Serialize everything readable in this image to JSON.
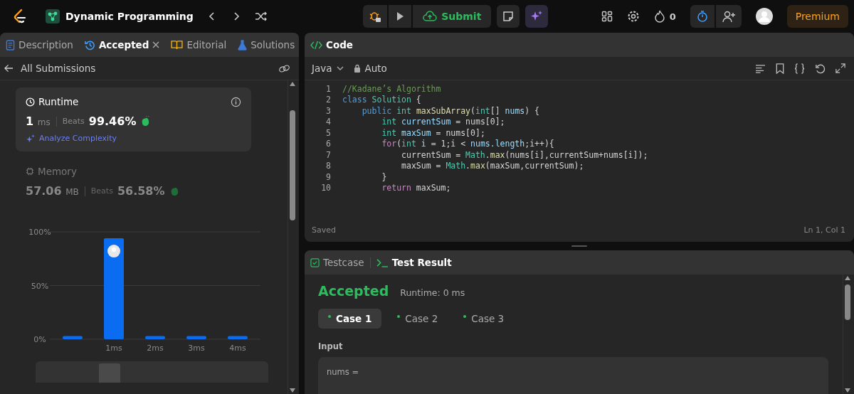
{
  "topbar": {
    "problem_list": "Dynamic Programming",
    "submit": "Submit",
    "streak": "0",
    "timer_active": true,
    "premium": "Premium"
  },
  "left_panel": {
    "tabs": [
      {
        "label": "Description",
        "kind": "description",
        "selected": false,
        "closable": false
      },
      {
        "label": "Accepted",
        "kind": "history",
        "selected": true,
        "closable": true
      },
      {
        "label": "Editorial",
        "kind": "book",
        "selected": false,
        "closable": false
      },
      {
        "label": "Solutions",
        "kind": "flask",
        "selected": false,
        "closable": false
      }
    ],
    "back_link": "All Submissions",
    "runtime": {
      "title": "Runtime",
      "value": "1 ",
      "unit": "ms",
      "beats_label": "Beats",
      "beats": "99.46%",
      "analyze": "Analyze Complexity",
      "selected": true
    },
    "memory": {
      "title": "Memory",
      "value": "57.06 ",
      "unit": "MB",
      "beats_label": "Beats",
      "beats": "56.58%",
      "selected": false
    },
    "chart_data": {
      "type": "bar",
      "categories": [
        null,
        "1ms",
        "2ms",
        "3ms",
        "4ms"
      ],
      "values": [
        3,
        94,
        3,
        3,
        3
      ],
      "yticks": [
        {
          "value": 0,
          "label": "0%"
        },
        {
          "value": 50,
          "label": "50%"
        },
        {
          "value": 100,
          "label": "100%"
        }
      ],
      "ylim": [
        0,
        100
      ]
    },
    "range": {
      "level": 0.3
    }
  },
  "code_panel": {
    "title": "Code",
    "language": "Java",
    "mode": "Auto",
    "status": "Saved",
    "cursor": "Ln 1, Col 1",
    "lines": [
      {
        "number": "1",
        "tokens": [
          {
            "t": "//Kadane’s Algorithm",
            "kind": "comment"
          }
        ]
      },
      {
        "number": "2",
        "tokens": [
          {
            "t": "class ",
            "kind": "keyword"
          },
          {
            "t": "Solution",
            "kind": "class"
          },
          {
            "t": " {",
            "kind": "plain"
          }
        ]
      },
      {
        "number": "3",
        "tokens": [
          {
            "t": "    public ",
            "kind": "keyword"
          },
          {
            "t": "int ",
            "kind": "type"
          },
          {
            "t": "maxSubArray",
            "kind": "function"
          },
          {
            "t": "(",
            "kind": "plain"
          },
          {
            "t": "int",
            "kind": "type"
          },
          {
            "t": "[] ",
            "kind": "plain"
          },
          {
            "t": "nums",
            "kind": "variable"
          },
          {
            "t": ") {",
            "kind": "plain"
          }
        ]
      },
      {
        "number": "4",
        "tokens": [
          {
            "t": "        int ",
            "kind": "type"
          },
          {
            "t": "currentSum",
            "kind": "variable"
          },
          {
            "t": " = nums[0];",
            "kind": "plain"
          }
        ]
      },
      {
        "number": "5",
        "tokens": [
          {
            "t": "        int ",
            "kind": "type"
          },
          {
            "t": "maxSum",
            "kind": "variable"
          },
          {
            "t": " = nums[0];",
            "kind": "plain"
          }
        ]
      },
      {
        "number": "6",
        "tokens": [
          {
            "t": "        for",
            "kind": "control"
          },
          {
            "t": "(",
            "kind": "plain"
          },
          {
            "t": "int ",
            "kind": "type"
          },
          {
            "t": "i",
            "kind": "variable"
          },
          {
            "t": " = 1;i < ",
            "kind": "plain"
          },
          {
            "t": "nums.length",
            "kind": "variable"
          },
          {
            "t": ";i++){",
            "kind": "plain"
          }
        ]
      },
      {
        "number": "7",
        "tokens": [
          {
            "t": "            currentSum = ",
            "kind": "plain"
          },
          {
            "t": "Math",
            "kind": "class"
          },
          {
            "t": ".",
            "kind": "plain"
          },
          {
            "t": "max",
            "kind": "function"
          },
          {
            "t": "(nums[i],currentSum+nums[i]);",
            "kind": "plain"
          }
        ]
      },
      {
        "number": "8",
        "tokens": [
          {
            "t": "            maxSum = ",
            "kind": "plain"
          },
          {
            "t": "Math",
            "kind": "class"
          },
          {
            "t": ".",
            "kind": "plain"
          },
          {
            "t": "max",
            "kind": "function"
          },
          {
            "t": "(maxSum,currentSum);",
            "kind": "plain"
          }
        ]
      },
      {
        "number": "9",
        "tokens": [
          {
            "t": "        }",
            "kind": "plain"
          }
        ]
      },
      {
        "number": "10",
        "tokens": [
          {
            "t": "        return ",
            "kind": "control"
          },
          {
            "t": "maxSum;",
            "kind": "plain"
          }
        ]
      }
    ]
  },
  "result_panel": {
    "tabs": [
      {
        "label": "Testcase",
        "kind": "check",
        "selected": false
      },
      {
        "label": "Test Result",
        "kind": "terminal",
        "selected": true
      }
    ],
    "verdict": "Accepted",
    "runtime": "Runtime: 0 ms",
    "cases": [
      {
        "label": "Case 1",
        "selected": true,
        "passed": true
      },
      {
        "label": "Case 2",
        "selected": false,
        "passed": true
      },
      {
        "label": "Case 3",
        "selected": false,
        "passed": true
      }
    ],
    "input_label": "Input",
    "input_name": "nums ="
  }
}
